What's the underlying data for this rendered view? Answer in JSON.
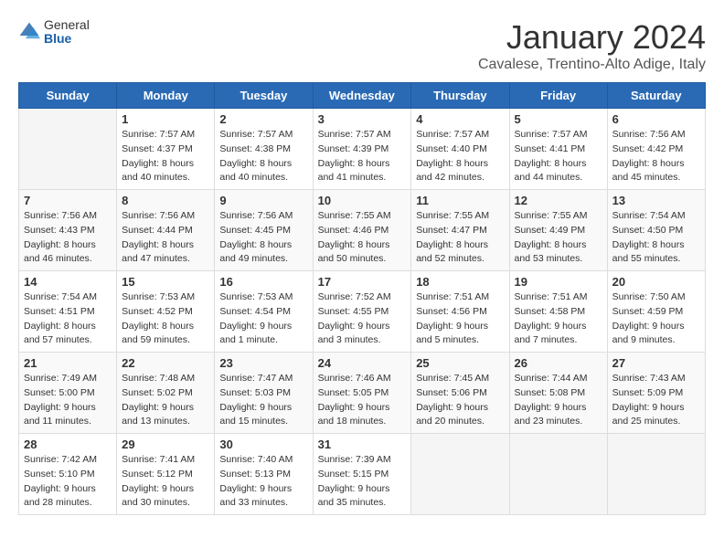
{
  "header": {
    "logo_general": "General",
    "logo_blue": "Blue",
    "month_title": "January 2024",
    "location": "Cavalese, Trentino-Alto Adige, Italy"
  },
  "days_of_week": [
    "Sunday",
    "Monday",
    "Tuesday",
    "Wednesday",
    "Thursday",
    "Friday",
    "Saturday"
  ],
  "weeks": [
    [
      {
        "day": "",
        "sunrise": "",
        "sunset": "",
        "daylight": ""
      },
      {
        "day": "1",
        "sunrise": "Sunrise: 7:57 AM",
        "sunset": "Sunset: 4:37 PM",
        "daylight": "Daylight: 8 hours and 40 minutes."
      },
      {
        "day": "2",
        "sunrise": "Sunrise: 7:57 AM",
        "sunset": "Sunset: 4:38 PM",
        "daylight": "Daylight: 8 hours and 40 minutes."
      },
      {
        "day": "3",
        "sunrise": "Sunrise: 7:57 AM",
        "sunset": "Sunset: 4:39 PM",
        "daylight": "Daylight: 8 hours and 41 minutes."
      },
      {
        "day": "4",
        "sunrise": "Sunrise: 7:57 AM",
        "sunset": "Sunset: 4:40 PM",
        "daylight": "Daylight: 8 hours and 42 minutes."
      },
      {
        "day": "5",
        "sunrise": "Sunrise: 7:57 AM",
        "sunset": "Sunset: 4:41 PM",
        "daylight": "Daylight: 8 hours and 44 minutes."
      },
      {
        "day": "6",
        "sunrise": "Sunrise: 7:56 AM",
        "sunset": "Sunset: 4:42 PM",
        "daylight": "Daylight: 8 hours and 45 minutes."
      }
    ],
    [
      {
        "day": "7",
        "sunrise": "Sunrise: 7:56 AM",
        "sunset": "Sunset: 4:43 PM",
        "daylight": "Daylight: 8 hours and 46 minutes."
      },
      {
        "day": "8",
        "sunrise": "Sunrise: 7:56 AM",
        "sunset": "Sunset: 4:44 PM",
        "daylight": "Daylight: 8 hours and 47 minutes."
      },
      {
        "day": "9",
        "sunrise": "Sunrise: 7:56 AM",
        "sunset": "Sunset: 4:45 PM",
        "daylight": "Daylight: 8 hours and 49 minutes."
      },
      {
        "day": "10",
        "sunrise": "Sunrise: 7:55 AM",
        "sunset": "Sunset: 4:46 PM",
        "daylight": "Daylight: 8 hours and 50 minutes."
      },
      {
        "day": "11",
        "sunrise": "Sunrise: 7:55 AM",
        "sunset": "Sunset: 4:47 PM",
        "daylight": "Daylight: 8 hours and 52 minutes."
      },
      {
        "day": "12",
        "sunrise": "Sunrise: 7:55 AM",
        "sunset": "Sunset: 4:49 PM",
        "daylight": "Daylight: 8 hours and 53 minutes."
      },
      {
        "day": "13",
        "sunrise": "Sunrise: 7:54 AM",
        "sunset": "Sunset: 4:50 PM",
        "daylight": "Daylight: 8 hours and 55 minutes."
      }
    ],
    [
      {
        "day": "14",
        "sunrise": "Sunrise: 7:54 AM",
        "sunset": "Sunset: 4:51 PM",
        "daylight": "Daylight: 8 hours and 57 minutes."
      },
      {
        "day": "15",
        "sunrise": "Sunrise: 7:53 AM",
        "sunset": "Sunset: 4:52 PM",
        "daylight": "Daylight: 8 hours and 59 minutes."
      },
      {
        "day": "16",
        "sunrise": "Sunrise: 7:53 AM",
        "sunset": "Sunset: 4:54 PM",
        "daylight": "Daylight: 9 hours and 1 minute."
      },
      {
        "day": "17",
        "sunrise": "Sunrise: 7:52 AM",
        "sunset": "Sunset: 4:55 PM",
        "daylight": "Daylight: 9 hours and 3 minutes."
      },
      {
        "day": "18",
        "sunrise": "Sunrise: 7:51 AM",
        "sunset": "Sunset: 4:56 PM",
        "daylight": "Daylight: 9 hours and 5 minutes."
      },
      {
        "day": "19",
        "sunrise": "Sunrise: 7:51 AM",
        "sunset": "Sunset: 4:58 PM",
        "daylight": "Daylight: 9 hours and 7 minutes."
      },
      {
        "day": "20",
        "sunrise": "Sunrise: 7:50 AM",
        "sunset": "Sunset: 4:59 PM",
        "daylight": "Daylight: 9 hours and 9 minutes."
      }
    ],
    [
      {
        "day": "21",
        "sunrise": "Sunrise: 7:49 AM",
        "sunset": "Sunset: 5:00 PM",
        "daylight": "Daylight: 9 hours and 11 minutes."
      },
      {
        "day": "22",
        "sunrise": "Sunrise: 7:48 AM",
        "sunset": "Sunset: 5:02 PM",
        "daylight": "Daylight: 9 hours and 13 minutes."
      },
      {
        "day": "23",
        "sunrise": "Sunrise: 7:47 AM",
        "sunset": "Sunset: 5:03 PM",
        "daylight": "Daylight: 9 hours and 15 minutes."
      },
      {
        "day": "24",
        "sunrise": "Sunrise: 7:46 AM",
        "sunset": "Sunset: 5:05 PM",
        "daylight": "Daylight: 9 hours and 18 minutes."
      },
      {
        "day": "25",
        "sunrise": "Sunrise: 7:45 AM",
        "sunset": "Sunset: 5:06 PM",
        "daylight": "Daylight: 9 hours and 20 minutes."
      },
      {
        "day": "26",
        "sunrise": "Sunrise: 7:44 AM",
        "sunset": "Sunset: 5:08 PM",
        "daylight": "Daylight: 9 hours and 23 minutes."
      },
      {
        "day": "27",
        "sunrise": "Sunrise: 7:43 AM",
        "sunset": "Sunset: 5:09 PM",
        "daylight": "Daylight: 9 hours and 25 minutes."
      }
    ],
    [
      {
        "day": "28",
        "sunrise": "Sunrise: 7:42 AM",
        "sunset": "Sunset: 5:10 PM",
        "daylight": "Daylight: 9 hours and 28 minutes."
      },
      {
        "day": "29",
        "sunrise": "Sunrise: 7:41 AM",
        "sunset": "Sunset: 5:12 PM",
        "daylight": "Daylight: 9 hours and 30 minutes."
      },
      {
        "day": "30",
        "sunrise": "Sunrise: 7:40 AM",
        "sunset": "Sunset: 5:13 PM",
        "daylight": "Daylight: 9 hours and 33 minutes."
      },
      {
        "day": "31",
        "sunrise": "Sunrise: 7:39 AM",
        "sunset": "Sunset: 5:15 PM",
        "daylight": "Daylight: 9 hours and 35 minutes."
      },
      {
        "day": "",
        "sunrise": "",
        "sunset": "",
        "daylight": ""
      },
      {
        "day": "",
        "sunrise": "",
        "sunset": "",
        "daylight": ""
      },
      {
        "day": "",
        "sunrise": "",
        "sunset": "",
        "daylight": ""
      }
    ]
  ]
}
